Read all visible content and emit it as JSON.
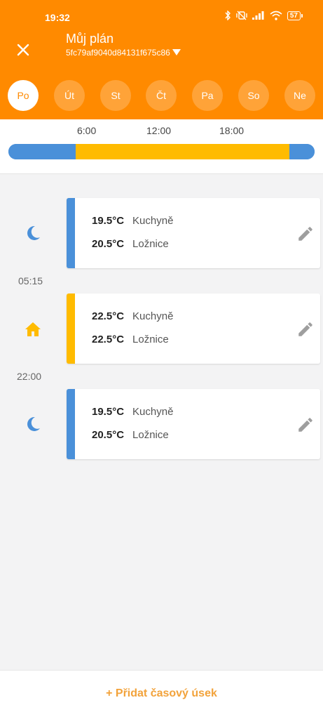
{
  "status_bar": {
    "time": "19:32",
    "battery": "57"
  },
  "header": {
    "title": "Můj plán",
    "plan_id": "5fc79af9040d84131f675c86",
    "accent_color": "#ff8a00"
  },
  "days": [
    {
      "label": "Po",
      "active": true
    },
    {
      "label": "Út",
      "active": false
    },
    {
      "label": "St",
      "active": false
    },
    {
      "label": "Čt",
      "active": false
    },
    {
      "label": "Pa",
      "active": false
    },
    {
      "label": "So",
      "active": false
    },
    {
      "label": "Ne",
      "active": false
    }
  ],
  "timeline": {
    "ticks": [
      "6:00",
      "12:00",
      "18:00"
    ],
    "segments": [
      {
        "mode": "night",
        "from": "00:00",
        "to": "05:15",
        "color": "#4a90d9"
      },
      {
        "mode": "home",
        "from": "05:15",
        "to": "22:00",
        "color": "#ffbb00"
      },
      {
        "mode": "night",
        "from": "22:00",
        "to": "24:00",
        "color": "#4a90d9"
      }
    ]
  },
  "slots": [
    {
      "mode_icon": "moon-icon",
      "color": "#4a90d9",
      "zones": [
        {
          "temp": "19.5°C",
          "room": "Kuchyně"
        },
        {
          "temp": "20.5°C",
          "room": "Ložnice"
        }
      ]
    },
    {
      "mode_icon": "home-icon",
      "color": "#ffbb00",
      "zones": [
        {
          "temp": "22.5°C",
          "room": "Kuchyně"
        },
        {
          "temp": "22.5°C",
          "room": "Ložnice"
        }
      ]
    },
    {
      "mode_icon": "moon-icon",
      "color": "#4a90d9",
      "zones": [
        {
          "temp": "19.5°C",
          "room": "Kuchyně"
        },
        {
          "temp": "20.5°C",
          "room": "Ložnice"
        }
      ]
    }
  ],
  "time_labels": [
    "05:15",
    "22:00"
  ],
  "footer": {
    "add_label": "+ Přidat časový úsek"
  }
}
